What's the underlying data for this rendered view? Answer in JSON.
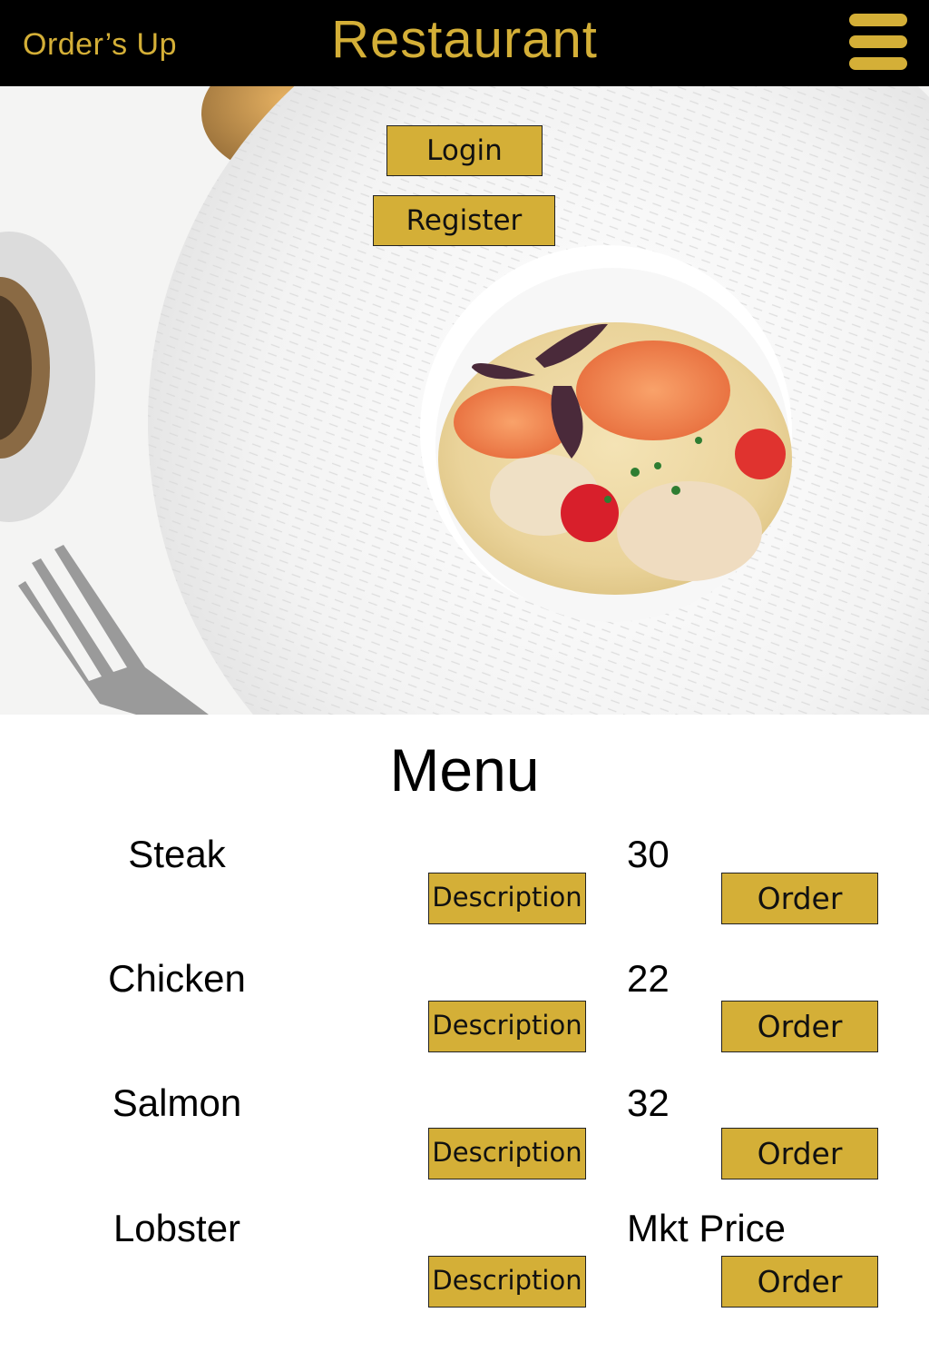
{
  "header": {
    "brand": "Order’s Up",
    "title": "Restaurant",
    "menu_icon": "hamburger-menu-icon"
  },
  "hero": {
    "image": "plated seafood dish with prawns in cream sauce on white plate",
    "login_label": "Login",
    "register_label": "Register"
  },
  "menu": {
    "title": "Menu",
    "items": [
      {
        "name": "Steak",
        "price": "30",
        "description_label": "Description",
        "order_label": "Order"
      },
      {
        "name": "Chicken",
        "price": "22",
        "description_label": "Description",
        "order_label": "Order"
      },
      {
        "name": "Salmon",
        "price": "32",
        "description_label": "Description",
        "order_label": "Order"
      },
      {
        "name": "Lobster",
        "price": "Mkt Price",
        "description_label": "Description",
        "order_label": "Order"
      }
    ]
  },
  "colors": {
    "gold": "#d4af37",
    "header_bg": "#000000",
    "text": "#000000"
  }
}
